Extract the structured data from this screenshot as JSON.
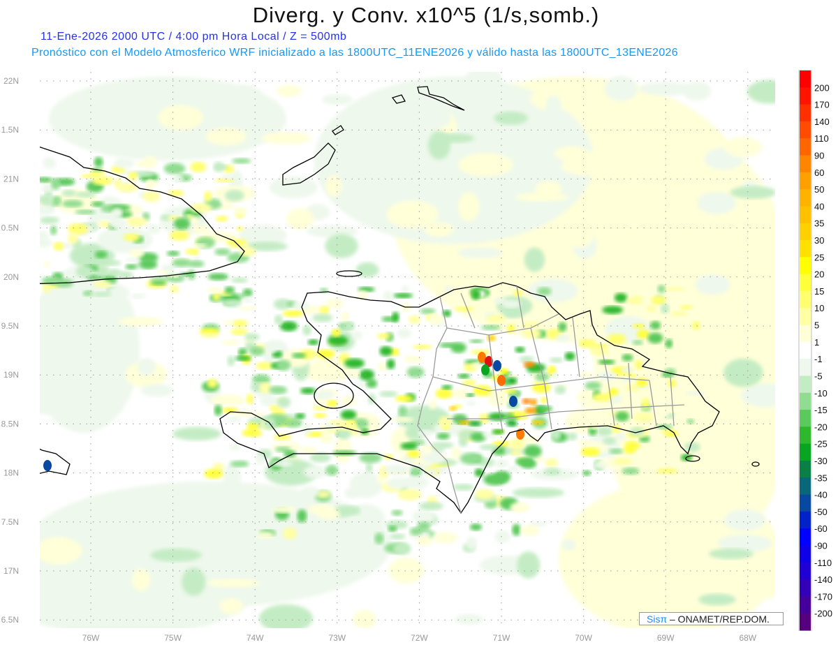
{
  "header": {
    "title": "Diverg. y Conv. x10^5 (1/s,somb.)",
    "subtitle_date": "11-Ene-2026  2000 UTC / 4:00 pm Hora Local / Z = 500mb",
    "subtitle_model": "Pronóstico con el Modelo Atmosferico WRF inicializado a las 1800UTC_11ENE2026 y válido hasta las  1800UTC_13ENE2026"
  },
  "map": {
    "lat_labels": [
      "22N",
      "1.5N",
      "21N",
      "0.5N",
      "20N",
      "9.5N",
      "19N",
      "8.5N",
      "18N",
      "7.5N",
      "17N",
      "6.5N"
    ],
    "lon_labels": [
      "76W",
      "75W",
      "74W",
      "73W",
      "72W",
      "71W",
      "70W",
      "69W",
      "68W"
    ],
    "grid": "dotted",
    "coastline_color": "#000000",
    "province_border_color": "#999999"
  },
  "colorbar": {
    "labels": [
      "200",
      "170",
      "140",
      "110",
      "90",
      "60",
      "50",
      "40",
      "35",
      "30",
      "25",
      "20",
      "15",
      "10",
      "5",
      "1",
      "-1",
      "-5",
      "-10",
      "-15",
      "-20",
      "-25",
      "-30",
      "-35",
      "-40",
      "-50",
      "-60",
      "-90",
      "-110",
      "-140",
      "-170",
      "-200"
    ],
    "colors": [
      "#ff0000",
      "#ff1400",
      "#ff3000",
      "#ff4c00",
      "#ff6600",
      "#ff8400",
      "#ffa000",
      "#ffb200",
      "#ffc000",
      "#ffd000",
      "#ffe000",
      "#ffff00",
      "#ffff3c",
      "#ffff70",
      "#ffffa4",
      "#ffffd8",
      "#ffffff",
      "#eef8ec",
      "#c4ecc4",
      "#90dc90",
      "#5cc95c",
      "#2db82d",
      "#08a620",
      "#0b8046",
      "#08687a",
      "#0848a0",
      "#0022c8",
      "#0000ff",
      "#1000e6",
      "#2000d2",
      "#3200b8",
      "#44009a",
      "#56007e"
    ]
  },
  "credit": {
    "brand": "Sisπ",
    "text": "– ONAMET/REP.DOM."
  }
}
